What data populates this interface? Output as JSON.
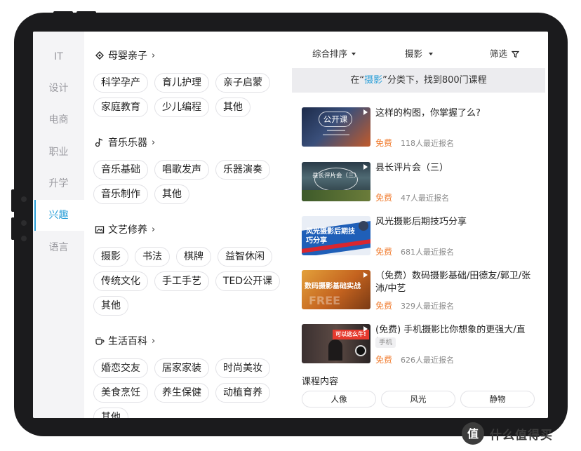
{
  "rail": {
    "items": [
      "IT",
      "设计",
      "电商",
      "职业",
      "升学",
      "兴趣",
      "语言"
    ],
    "active_index": 5
  },
  "sections": [
    {
      "title": "母婴亲子",
      "icon": "baby-bottle-icon",
      "tags": [
        "科学孕产",
        "育儿护理",
        "亲子启蒙",
        "家庭教育",
        "少儿编程",
        "其他"
      ]
    },
    {
      "title": "音乐乐器",
      "icon": "music-note-icon",
      "tags": [
        "音乐基础",
        "唱歌发声",
        "乐器演奏",
        "音乐制作",
        "其他"
      ]
    },
    {
      "title": "文艺修养",
      "icon": "picture-frame-icon",
      "tags": [
        "摄影",
        "书法",
        "棋牌",
        "益智休闲",
        "传统文化",
        "手工手艺",
        "TED公开课",
        "其他"
      ]
    },
    {
      "title": "生活百科",
      "icon": "coffee-cup-icon",
      "tags": [
        "婚恋交友",
        "居家家装",
        "时尚美妆",
        "美食烹饪",
        "养生保健",
        "动植育养",
        "其他"
      ]
    }
  ],
  "filters": {
    "sort": "综合排序",
    "category": "摄影",
    "filter": "筛选"
  },
  "result": {
    "prefix": "在“",
    "keyword": "摄影",
    "suffix": "”分类下，找到800门课程"
  },
  "courses": [
    {
      "title": "这样的构图，你掌握了么?",
      "price": "免费",
      "enrolled": "118人最近报名",
      "thumb_text": "公开课",
      "tag": ""
    },
    {
      "title": "县长评片会（三）",
      "price": "免费",
      "enrolled": "47人最近报名",
      "thumb_text": "县长评片会（三）",
      "tag": ""
    },
    {
      "title": "风光摄影后期技巧分享",
      "price": "免费",
      "enrolled": "681人最近报名",
      "thumb_text": "风光摄影后期技巧分享",
      "tag": ""
    },
    {
      "title": "（免费）数码摄影基础/田德友/郭卫/张沛/中艺",
      "price": "免费",
      "enrolled": "329人最近报名",
      "thumb_text": "数码摄影基础实战",
      "tag": ""
    },
    {
      "title": "(免费) 手机摄影比你想象的更强大/直播/...",
      "price": "免费",
      "enrolled": "626人最近报名",
      "thumb_text": "可以这么牛!",
      "tag": "手机"
    }
  ],
  "content": {
    "heading": "课程内容",
    "pills": [
      "人像",
      "风光",
      "静物"
    ]
  },
  "watermark": {
    "text": "什么值得买",
    "badge": "值"
  },
  "colors": {
    "accent": "#2a9fd8",
    "free": "#f07a2c",
    "frame": "#1b1b1d"
  }
}
